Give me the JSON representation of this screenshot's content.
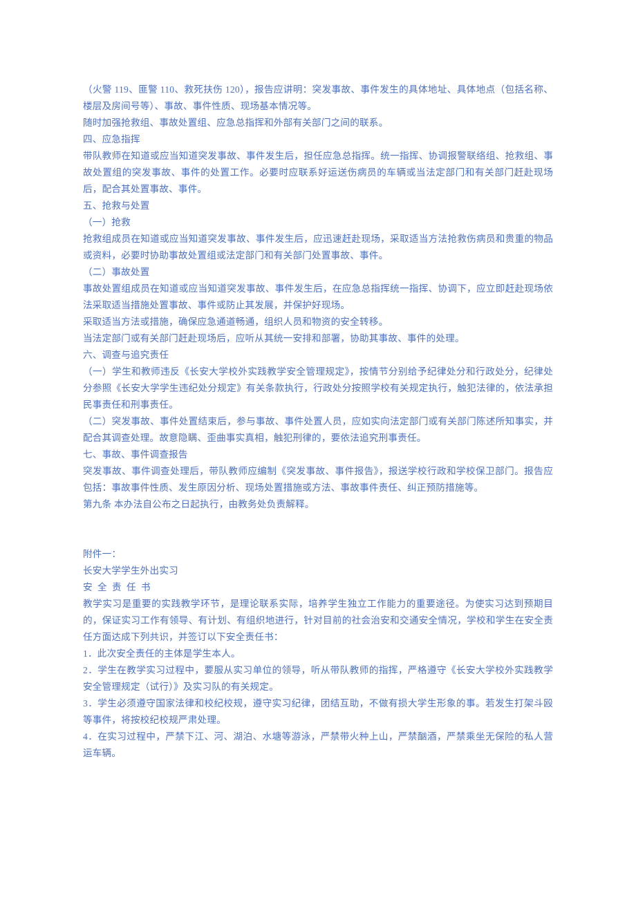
{
  "paragraphs": [
    "（火警 119、匪警 110、救死扶伤 120），报告应讲明：突发事故、事件发生的具体地址、具体地点（包括名称、楼层及房间号等）、事故、事件性质、现场基本情况等。",
    "随时加强抢救组、事故处置组、应急总指挥和外部有关部门之间的联系。",
    "四、应急指挥",
    "带队教师在知道或应当知道突发事故、事件发生后，担任应急总指挥。统一指挥、协调报警联络组、抢救组、事故处置组的突发事故、事件的处置工作。必要时应联系好运送伤病员的车辆或当法定部门和有关部门赶赴现场后，配合其处置事故、事件。",
    "五、抢救与处置",
    "（一）抢救",
    "抢救组成员在知道或应当知道突发事故、事件发生后，应迅速赶赴现场，采取适当方法抢救伤病员和贵重的物品或资料，必要时协助事故处置组或法定部门和有关部门处置事故、事件。",
    "（二）事故处置",
    "事故处置组成员在知道或应当知道突发事故、事件发生后，在应急总指挥统一指挥、协调下，应立即赶赴现场依法采取适当措施处置事故、事件或防止其发展，并保护好现场。",
    "采取适当方法或措施，确保应急通道畅通，组织人员和物资的安全转移。",
    "当法定部门或有关部门赶赴现场后，应听从其统一安排和部署，协助其事故、事件的处理。",
    "六、调查与追究责任",
    "（一）学生和教师违反《长安大学校外实践教学安全管理规定》，按情节分别给予纪律处分和行政处分，纪律处分参照《长安大学学生违纪处分规定》有关条款执行，行政处分按照学校有关规定执行，触犯法律的，依法承担民事责任和刑事责任。",
    "（二）突发事故、事件处置结束后，参与事故、事件处置人员，应如实向法定部门或有关部门陈述所知事实，并配合其调查处理。故意隐瞒、歪曲事实真相，触犯刑律的，要依法追究刑事责任。",
    "七、事故、事件调查报告",
    "突发事故、事件调查处理后，带队教师应编制《突发事故、事件报告》，报送学校行政和学校保卫部门。报告应包括：事故事件性质、发生原因分析、现场处置措施或方法、事故事件责任、纠正预防措施等。",
    "第九条  本办法自公布之日起执行，由教务处负责解释。"
  ],
  "appendix": {
    "label": "附件一：",
    "line1": "长安大学学生外出实习",
    "line2": "安 全 责 任 书",
    "intro": "教学实习是重要的实践教学环节，是理论联系实际，培养学生独立工作能力的重要途径。为使实习达到预期目的，保证实习工作有领导、有计划、有组织地进行，针对目前的社会治安和交通安全情况，学校和学生在安全责任方面达成下列共识，并签订以下安全责任书：",
    "items": [
      "1．此次安全责任的主体是学生本人。",
      "2．学生在教学实习过程中，要服从实习单位的领导，听从带队教师的指挥，严格遵守《长安大学校外实践教学安全管理规定（试行）》及实习队的有关规定。",
      "3．学生必须遵守国家法律和校纪校规，遵守实习纪律，团结互助，不做有损大学生形象的事。若发生打架斗殴等事件，将按校纪校规严肃处理。",
      "4．在实习过程中，严禁下江、河、湖泊、水塘等游泳，严禁带火种上山，严禁酗酒，严禁乘坐无保险的私人营运车辆。"
    ]
  }
}
